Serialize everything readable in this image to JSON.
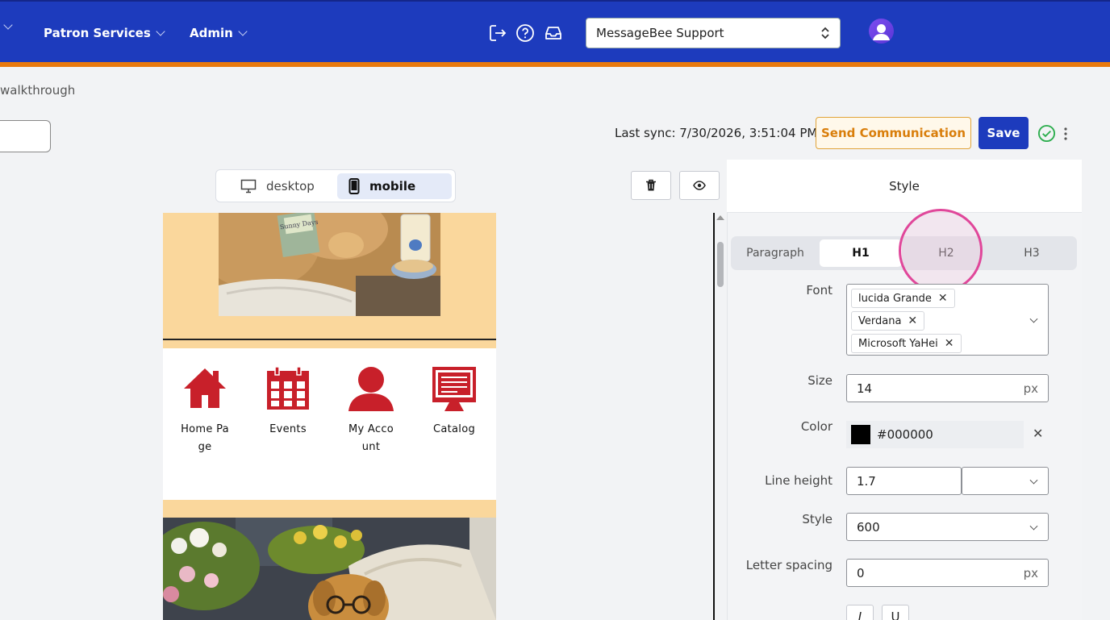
{
  "header": {
    "nav": [
      {
        "label": ""
      },
      {
        "label": "Patron Services"
      },
      {
        "label": "Admin"
      }
    ],
    "org_select": "MessageBee Support"
  },
  "breadcrumb": "walkthrough",
  "toolbar": {
    "sync_text": "Last sync: 7/30/2026, 3:51:04 PM",
    "send_label": "Send Communication",
    "save_label": "Save"
  },
  "device_toggle": {
    "desktop_label": "desktop",
    "mobile_label": "mobile",
    "active": "mobile"
  },
  "preview": {
    "links": [
      {
        "label": "Home Page",
        "icon": "home-icon"
      },
      {
        "label": "Events",
        "icon": "calendar-icon"
      },
      {
        "label": "My Account",
        "icon": "user-icon"
      },
      {
        "label": "Catalog",
        "icon": "monitor-icon"
      }
    ],
    "book_title": "Sunny Days"
  },
  "style_panel": {
    "title": "Style",
    "tabs": [
      {
        "label": "Paragraph"
      },
      {
        "label": "H1"
      },
      {
        "label": "H2"
      },
      {
        "label": "H3"
      }
    ],
    "active_tab": "H1",
    "font": {
      "label": "Font",
      "tags": [
        "lucida Grande",
        "Verdana",
        "Microsoft YaHei"
      ]
    },
    "size": {
      "label": "Size",
      "value": "14",
      "unit": "px"
    },
    "color": {
      "label": "Color",
      "value": "#000000"
    },
    "line_height": {
      "label": "Line height",
      "value": "1.7",
      "unit_value": ""
    },
    "style": {
      "label": "Style",
      "value": "600"
    },
    "letter_spacing": {
      "label": "Letter spacing",
      "value": "0",
      "unit": "px"
    },
    "format_buttons": [
      "I",
      "U"
    ]
  },
  "colors": {
    "topbar": "#1d3bbd",
    "accent_stripe": "#e8790e",
    "send_button": "#d97e0b",
    "icon_red": "#c8202a",
    "highlight": "#e0479a"
  }
}
